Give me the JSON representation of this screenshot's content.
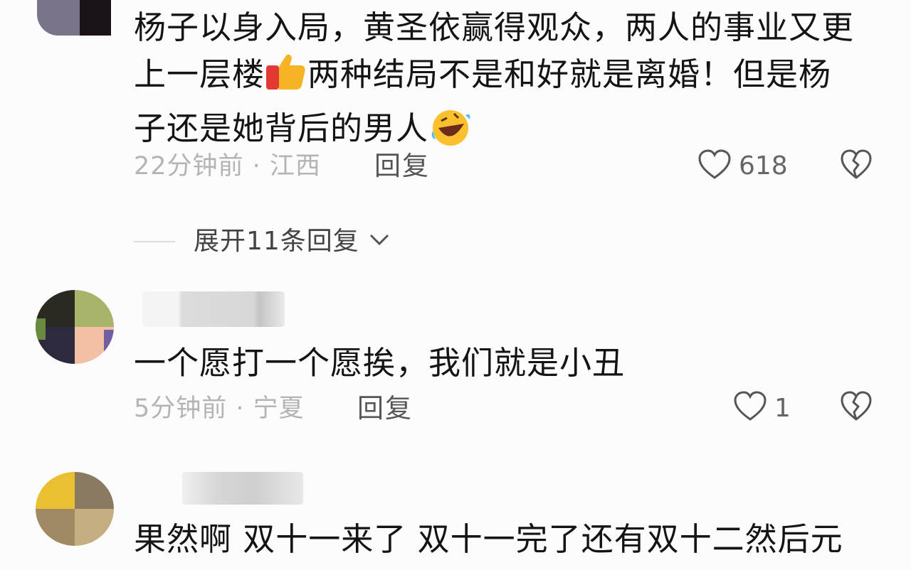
{
  "comments": [
    {
      "text_lines": [
        "杨子以身入局，黄圣依赢得观众，两人的事业又更",
        "上一层楼",
        "两种结局不是和好就是离婚！但是杨",
        "子还是她背后的男人"
      ],
      "time_location": "22分钟前 · 江西",
      "reply_label": "回复",
      "likes": "618"
    },
    {
      "text": "一个愿打一个愿挨，我们就是小丑",
      "time_location": "5分钟前 · 宁夏",
      "reply_label": "回复",
      "likes": "1"
    },
    {
      "text": "果然啊 双十一来了 双十一完了还有双十二然后元"
    }
  ],
  "expand_replies": "展开11条回复",
  "icons": {
    "like": "heart-outline-icon",
    "dislike": "broken-heart-icon",
    "expand": "chevron-down-icon",
    "emoji1": "thumbs-up-emoji",
    "emoji2": "rolling-laughing-emoji"
  }
}
